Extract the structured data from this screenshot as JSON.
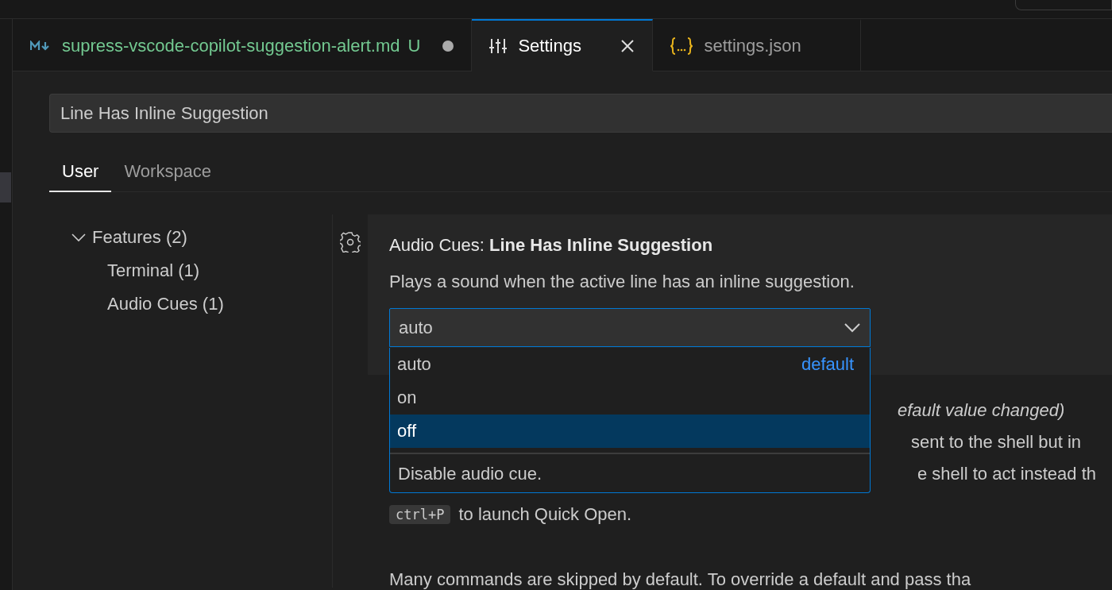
{
  "editor_tabs": [
    {
      "label": "supress-vscode-copilot-suggestion-alert.md",
      "kind": "markdown",
      "selected": false,
      "git_status": "U",
      "dirty": true
    },
    {
      "label": "Settings",
      "kind": "settings",
      "selected": true,
      "dirty": false
    },
    {
      "label": "settings.json",
      "kind": "json",
      "selected": false,
      "dirty": false
    }
  ],
  "search": {
    "value": "Line Has Inline Suggestion"
  },
  "scope_tabs": [
    {
      "label": "User",
      "selected": true
    },
    {
      "label": "Workspace",
      "selected": false
    }
  ],
  "toc": [
    {
      "label": "Features (2)",
      "expanded": true,
      "children": [
        {
          "label": "Terminal (1)"
        },
        {
          "label": "Audio Cues (1)"
        }
      ]
    }
  ],
  "setting": {
    "category": "Audio Cues: ",
    "title": "Line Has Inline Suggestion",
    "description": "Plays a sound when the active line has an inline suggestion.",
    "value": "auto",
    "dropdown": {
      "options": [
        {
          "label": "auto",
          "badge": "default",
          "selected": false
        },
        {
          "label": "on",
          "selected": false
        },
        {
          "label": "off",
          "selected": true
        }
      ],
      "option_description": "Disable audio cue."
    }
  },
  "background_setting": {
    "lines": [
      {
        "text": "efault value changed)",
        "kind": "italic"
      },
      {
        "text": "sent to the shell but in",
        "kind": "plain"
      },
      {
        "text": "e shell to act instead th",
        "kind": "plain"
      }
    ],
    "keybinding": "ctrl+P",
    "keybinding_text": "to launch Quick Open.",
    "paragraph": "Many commands are skipped by default. To override a default and pass tha"
  }
}
